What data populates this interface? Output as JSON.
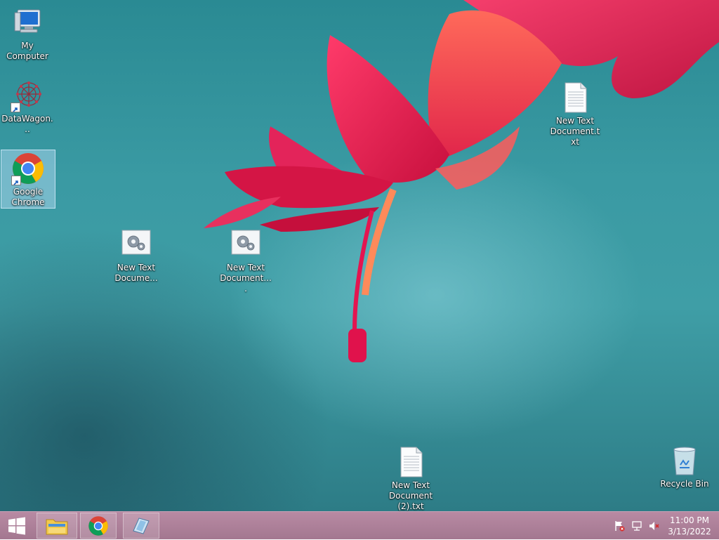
{
  "desktop": {
    "icons": [
      {
        "label": "My Computer",
        "icon": "computer-icon"
      },
      {
        "label": "DataWagon...",
        "icon": "datawagon-icon"
      },
      {
        "label": "Google Chrome",
        "icon": "chrome-icon"
      },
      {
        "label": "New Text Docume...",
        "icon": "config-file-icon"
      },
      {
        "label": "New Text Document....",
        "icon": "config-file-icon"
      },
      {
        "label": "New Text Document.txt",
        "icon": "text-file-icon"
      },
      {
        "label": "New Text Document (2).txt",
        "icon": "text-file-icon"
      },
      {
        "label": "Recycle Bin",
        "icon": "recycle-bin-icon"
      }
    ],
    "selected_icon": "Google Chrome"
  },
  "taskbar": {
    "accent_color": "#ad8098",
    "pinned": [
      {
        "name": "File Explorer",
        "icon": "file-explorer-icon"
      },
      {
        "name": "Google Chrome",
        "icon": "chrome-icon"
      },
      {
        "name": "Notepad",
        "icon": "notepad-icon"
      }
    ],
    "tray": {
      "icons": [
        "action-center-flag-icon",
        "network-icon",
        "volume-muted-icon"
      ],
      "time": "11:00 PM",
      "date": "3/13/2022"
    }
  }
}
